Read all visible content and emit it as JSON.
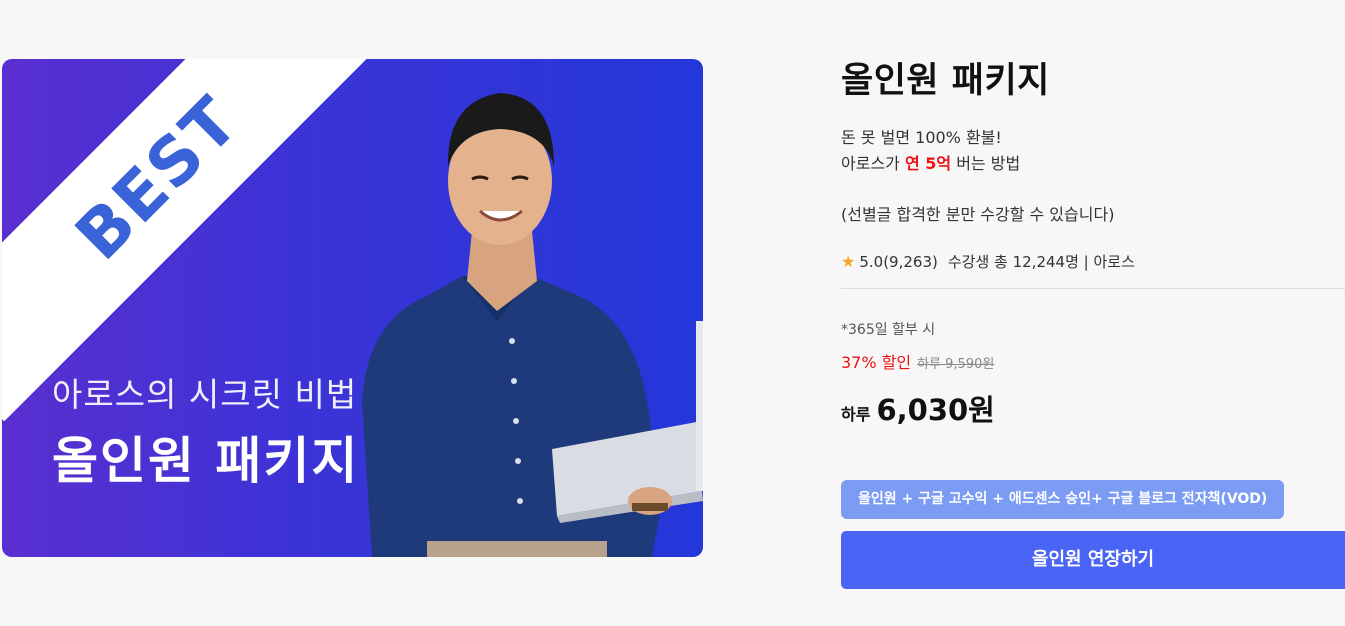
{
  "banner": {
    "badge": "BEST",
    "subtitle": "아로스의 시크릿 비법",
    "title": "올인원 패키지",
    "gradient_start": "#5a2fd0",
    "gradient_end": "#2437d9",
    "badge_color": "#3b63d8"
  },
  "product": {
    "title": "올인원 패키지",
    "desc_line1": "돈 못 벌면 100% 환불!",
    "desc_line2_pre": "아로스가 ",
    "desc_line2_highlight": "연 5억",
    "desc_line2_post": " 버는 방법",
    "notice": "(선별글 합격한 분만 수강할 수 있습니다)",
    "rating": "5.0(9,263)",
    "students": "수강생 총 12,244명 | 아로스",
    "star_icon": "star-icon"
  },
  "pricing": {
    "installment_note": "*365일 할부 시",
    "discount": "37% 할인",
    "original_price": "하루 9,590원",
    "price_prefix": "하루",
    "price": "6,030원"
  },
  "option": {
    "label": "올인원 + 구글 고수익 + 애드센스 승인+ 구글 블로그 전자책(VOD)"
  },
  "cta": {
    "label": "올인원 연장하기"
  },
  "colors": {
    "accent": "#4a64f5",
    "chip": "#7c9cf4",
    "highlight": "#ee1111"
  }
}
